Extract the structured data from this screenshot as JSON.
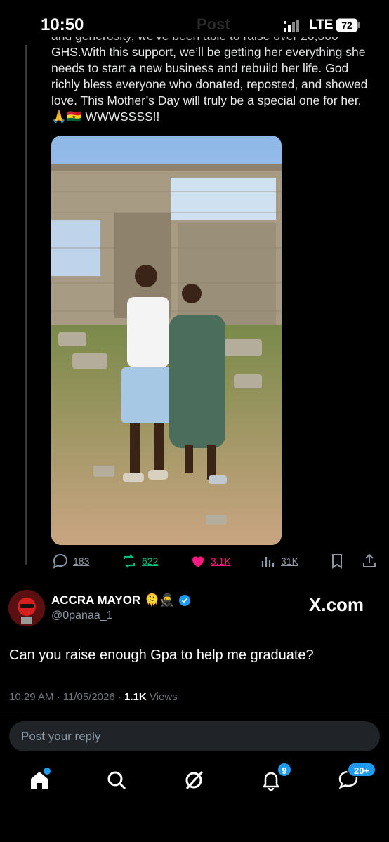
{
  "status_bar": {
    "time": "10:50",
    "ghost_title": "Post",
    "network": "LTE",
    "battery": "72"
  },
  "quoted_post": {
    "text_cut_top": "and generosity, we've been able to raise over 20,000",
    "text": "GHS.With this support, we’ll be getting her everything she needs to start a new business and rebuild her life. God richly bless everyone who donated, reposted, and showed love. This Mother’s Day will truly be a special one for her. 🙏🇬🇭 WWWSSSS!!",
    "actions": {
      "replies": "183",
      "reposts": "622",
      "likes": "3.1K",
      "views": "31K"
    }
  },
  "post": {
    "author_name": "ACCRA MAYOR",
    "author_emoji": "🫠🥷",
    "handle": "@0panaa_1",
    "watermark": "X.com",
    "text": "Can you raise enough Gpa to help me graduate?",
    "time": "10:29 AM",
    "date": "11/05/2026",
    "views_count": "1.1K",
    "views_label": "Views"
  },
  "reply_box": {
    "placeholder": "Post your reply"
  },
  "nav": {
    "notifications_badge": "9",
    "messages_badge": "20+"
  },
  "colors": {
    "accent": "#1d9bf0",
    "like": "#f91880",
    "repost": "#00ba7c",
    "muted": "#8b98a5"
  }
}
